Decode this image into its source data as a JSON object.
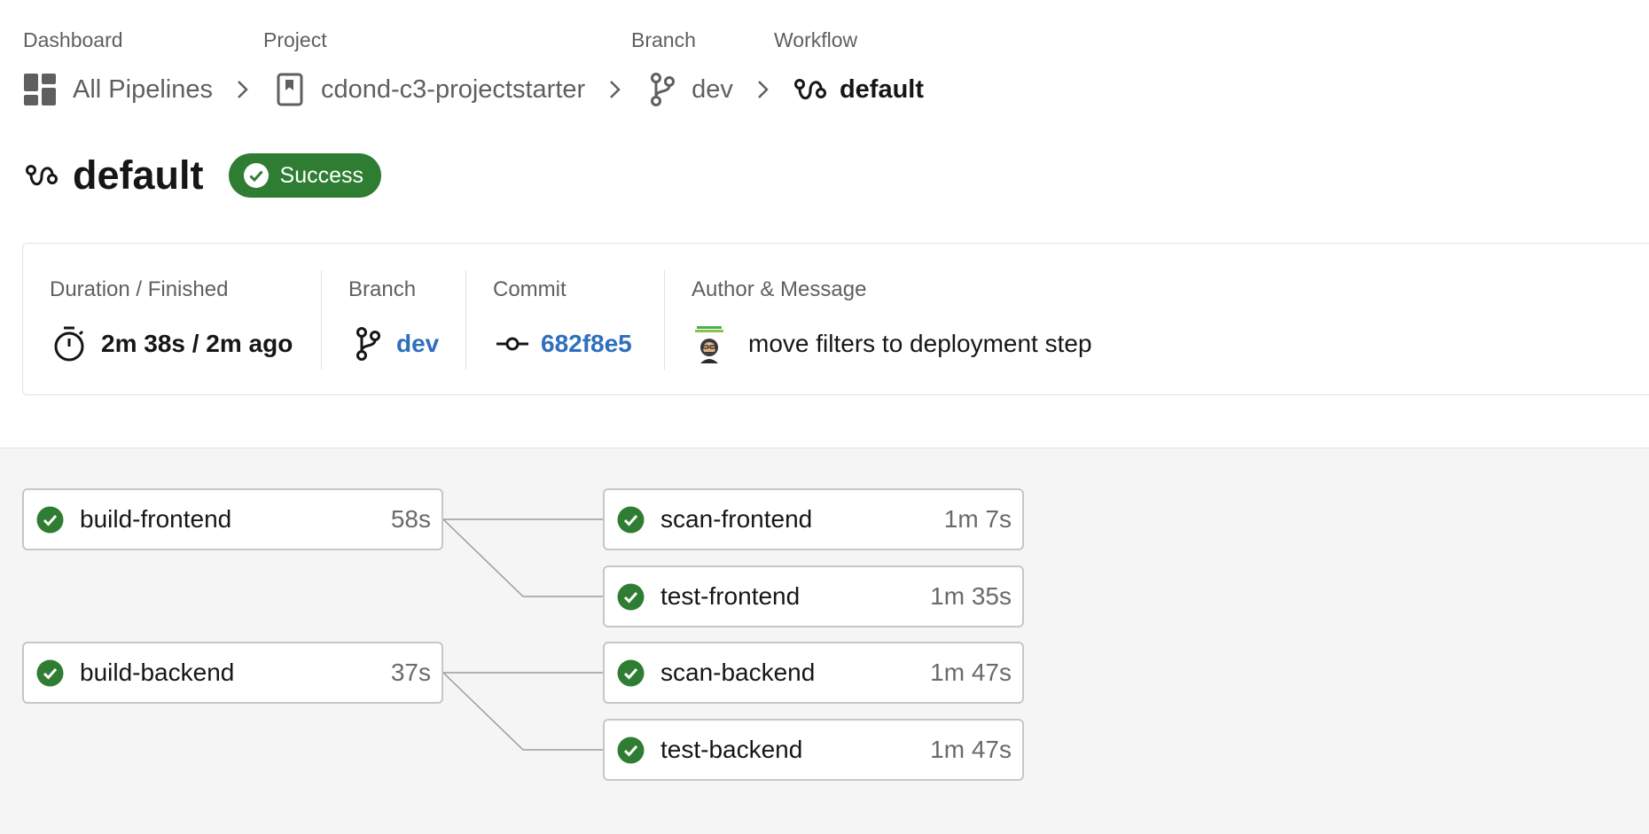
{
  "breadcrumb": {
    "labels": {
      "dashboard": "Dashboard",
      "project": "Project",
      "branch": "Branch",
      "workflow": "Workflow"
    },
    "items": [
      {
        "text": "All Pipelines",
        "icon": "dashboard-grid-icon"
      },
      {
        "text": "cdond-c3-projectstarter",
        "icon": "bookmark-icon"
      },
      {
        "text": "dev",
        "icon": "branch-icon"
      },
      {
        "text": "default",
        "icon": "workflow-icon"
      }
    ],
    "separator_icon": "chevron-right-icon"
  },
  "header": {
    "title": "default",
    "title_icon": "workflow-icon",
    "status": "Success",
    "status_color": "#2e7d32"
  },
  "summary": {
    "duration": {
      "label": "Duration / Finished",
      "value": "2m 38s / 2m ago",
      "icon": "stopwatch-icon"
    },
    "branch": {
      "label": "Branch",
      "value": "dev",
      "icon": "branch-icon"
    },
    "commit": {
      "label": "Commit",
      "value": "682f8e5",
      "icon": "commit-icon"
    },
    "author": {
      "label": "Author & Message",
      "message": "move filters to deployment step",
      "icon": "avatar"
    }
  },
  "jobs": [
    {
      "name": "build-frontend",
      "duration": "58s",
      "status": "success"
    },
    {
      "name": "scan-frontend",
      "duration": "1m 7s",
      "status": "success"
    },
    {
      "name": "test-frontend",
      "duration": "1m 35s",
      "status": "success"
    },
    {
      "name": "build-backend",
      "duration": "37s",
      "status": "success"
    },
    {
      "name": "scan-backend",
      "duration": "1m 47s",
      "status": "success"
    },
    {
      "name": "test-backend",
      "duration": "1m 47s",
      "status": "success"
    }
  ],
  "colors": {
    "link": "#2f6fbe",
    "success": "#2e7d32",
    "graph_background": "#f5f5f5"
  }
}
